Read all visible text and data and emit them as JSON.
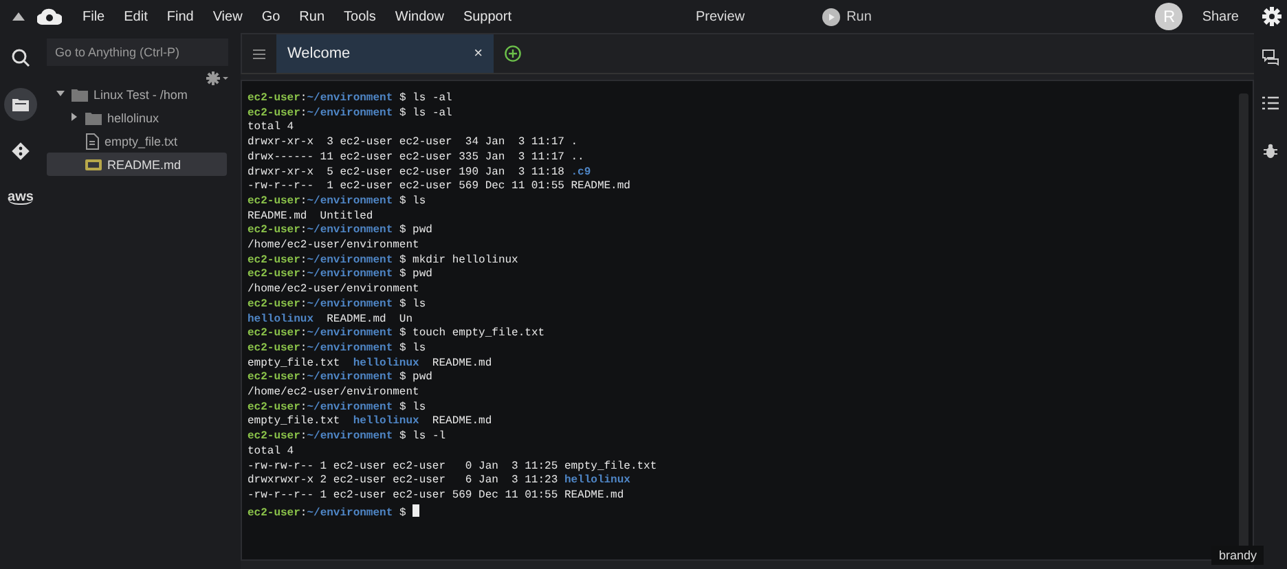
{
  "menu_bar": {
    "items": [
      "File",
      "Edit",
      "Find",
      "View",
      "Go",
      "Run",
      "Tools",
      "Window",
      "Support"
    ],
    "preview": "Preview",
    "run": "Run",
    "avatar": "R",
    "share": "Share"
  },
  "left_rail": {
    "items": [
      {
        "kind": "search",
        "selected": false
      },
      {
        "kind": "files",
        "selected": true
      },
      {
        "kind": "git",
        "selected": false
      },
      {
        "kind": "aws",
        "label": "aws",
        "selected": false
      }
    ]
  },
  "file_tree": {
    "search": {
      "placeholder": "Go to Anything (Ctrl-P)"
    },
    "items": [
      {
        "label": "Linux Test - /hom",
        "kind": "folder",
        "expanded": true,
        "selected": false,
        "children": [
          {
            "label": "hellolinux",
            "kind": "folder",
            "expanded": false,
            "selected": false
          },
          {
            "label": "empty_file.txt",
            "kind": "file",
            "selected": false
          },
          {
            "label": "README.md",
            "kind": "markdown",
            "selected": true
          }
        ]
      }
    ]
  },
  "tabs": [
    {
      "label": "Welcome",
      "selected": true,
      "close": "×"
    }
  ],
  "terminal": {
    "lines": [
      {
        "segments": [
          {
            "kind": "user",
            "text": "ec2-user"
          },
          {
            "kind": "plain",
            "text": ":"
          },
          {
            "kind": "path",
            "text": "~/environment"
          },
          {
            "kind": "plain",
            "text": " $ ls -al"
          }
        ]
      },
      {
        "segments": [
          {
            "kind": "user",
            "text": "ec2-user"
          },
          {
            "kind": "plain",
            "text": ":"
          },
          {
            "kind": "path",
            "text": "~/environment"
          },
          {
            "kind": "plain",
            "text": " $ ls -al"
          }
        ]
      },
      {
        "segments": [
          {
            "kind": "plain",
            "text": "total 4"
          }
        ]
      },
      {
        "segments": [
          {
            "kind": "plain",
            "text": "drwxr-xr-x  3 ec2-user ec2-user  34 Jan  3 11:17 ."
          }
        ]
      },
      {
        "segments": [
          {
            "kind": "plain",
            "text": "drwx------ 11 ec2-user ec2-user 335 Jan  3 11:17 .."
          }
        ]
      },
      {
        "segments": [
          {
            "kind": "plain",
            "text": "drwxr-xr-x  5 ec2-user ec2-user 190 Jan  3 11:18 "
          },
          {
            "kind": "dir",
            "text": ".c9"
          }
        ]
      },
      {
        "segments": [
          {
            "kind": "plain",
            "text": "-rw-r--r--  1 ec2-user ec2-user 569 Dec 11 01:55 README.md"
          }
        ]
      },
      {
        "segments": [
          {
            "kind": "user",
            "text": "ec2-user"
          },
          {
            "kind": "plain",
            "text": ":"
          },
          {
            "kind": "path",
            "text": "~/environment"
          },
          {
            "kind": "plain",
            "text": " $ ls"
          }
        ]
      },
      {
        "segments": [
          {
            "kind": "plain",
            "text": "README.md  Untitled"
          }
        ]
      },
      {
        "segments": [
          {
            "kind": "user",
            "text": "ec2-user"
          },
          {
            "kind": "plain",
            "text": ":"
          },
          {
            "kind": "path",
            "text": "~/environment"
          },
          {
            "kind": "plain",
            "text": " $ pwd"
          }
        ]
      },
      {
        "segments": [
          {
            "kind": "plain",
            "text": "/home/ec2-user/environment"
          }
        ]
      },
      {
        "segments": [
          {
            "kind": "user",
            "text": "ec2-user"
          },
          {
            "kind": "plain",
            "text": ":"
          },
          {
            "kind": "path",
            "text": "~/environment"
          },
          {
            "kind": "plain",
            "text": " $ mkdir hellolinux"
          }
        ]
      },
      {
        "segments": [
          {
            "kind": "user",
            "text": "ec2-user"
          },
          {
            "kind": "plain",
            "text": ":"
          },
          {
            "kind": "path",
            "text": "~/environment"
          },
          {
            "kind": "plain",
            "text": " $ pwd"
          }
        ]
      },
      {
        "segments": [
          {
            "kind": "plain",
            "text": "/home/ec2-user/environment"
          }
        ]
      },
      {
        "segments": [
          {
            "kind": "user",
            "text": "ec2-user"
          },
          {
            "kind": "plain",
            "text": ":"
          },
          {
            "kind": "path",
            "text": "~/environment"
          },
          {
            "kind": "plain",
            "text": " $ ls"
          }
        ]
      },
      {
        "segments": [
          {
            "kind": "dir",
            "text": "hellolinux"
          },
          {
            "kind": "plain",
            "text": "  README.md  Un"
          }
        ]
      },
      {
        "segments": [
          {
            "kind": "user",
            "text": "ec2-user"
          },
          {
            "kind": "plain",
            "text": ":"
          },
          {
            "kind": "path",
            "text": "~/environment"
          },
          {
            "kind": "plain",
            "text": " $ touch empty_file.txt"
          }
        ]
      },
      {
        "segments": [
          {
            "kind": "user",
            "text": "ec2-user"
          },
          {
            "kind": "plain",
            "text": ":"
          },
          {
            "kind": "path",
            "text": "~/environment"
          },
          {
            "kind": "plain",
            "text": " $ ls"
          }
        ]
      },
      {
        "segments": [
          {
            "kind": "plain",
            "text": "empty_file.txt  "
          },
          {
            "kind": "dir",
            "text": "hellolinux"
          },
          {
            "kind": "plain",
            "text": "  README.md"
          }
        ]
      },
      {
        "segments": [
          {
            "kind": "user",
            "text": "ec2-user"
          },
          {
            "kind": "plain",
            "text": ":"
          },
          {
            "kind": "path",
            "text": "~/environment"
          },
          {
            "kind": "plain",
            "text": " $ pwd"
          }
        ]
      },
      {
        "segments": [
          {
            "kind": "plain",
            "text": "/home/ec2-user/environment"
          }
        ]
      },
      {
        "segments": [
          {
            "kind": "user",
            "text": "ec2-user"
          },
          {
            "kind": "plain",
            "text": ":"
          },
          {
            "kind": "path",
            "text": "~/environment"
          },
          {
            "kind": "plain",
            "text": " $ ls"
          }
        ]
      },
      {
        "segments": [
          {
            "kind": "plain",
            "text": "empty_file.txt  "
          },
          {
            "kind": "dir",
            "text": "hellolinux"
          },
          {
            "kind": "plain",
            "text": "  README.md"
          }
        ]
      },
      {
        "segments": [
          {
            "kind": "user",
            "text": "ec2-user"
          },
          {
            "kind": "plain",
            "text": ":"
          },
          {
            "kind": "path",
            "text": "~/environment"
          },
          {
            "kind": "plain",
            "text": " $ ls -l"
          }
        ]
      },
      {
        "segments": [
          {
            "kind": "plain",
            "text": "total 4"
          }
        ]
      },
      {
        "segments": [
          {
            "kind": "plain",
            "text": "-rw-rw-r-- 1 ec2-user ec2-user   0 Jan  3 11:25 empty_file.txt"
          }
        ]
      },
      {
        "segments": [
          {
            "kind": "plain",
            "text": "drwxrwxr-x 2 ec2-user ec2-user   6 Jan  3 11:23 "
          },
          {
            "kind": "dir",
            "text": "hellolinux"
          }
        ]
      },
      {
        "segments": [
          {
            "kind": "plain",
            "text": "-rw-r--r-- 1 ec2-user ec2-user 569 Dec 11 01:55 README.md"
          }
        ]
      },
      {
        "segments": [
          {
            "kind": "user",
            "text": "ec2-user"
          },
          {
            "kind": "plain",
            "text": ":"
          },
          {
            "kind": "path",
            "text": "~/environment"
          },
          {
            "kind": "plain",
            "text": " $ "
          }
        ],
        "cursor": true
      }
    ],
    "tooltip": "brandy"
  },
  "right_rail": {
    "items": [
      {
        "kind": "chat"
      },
      {
        "kind": "outline"
      },
      {
        "kind": "debug"
      }
    ]
  }
}
